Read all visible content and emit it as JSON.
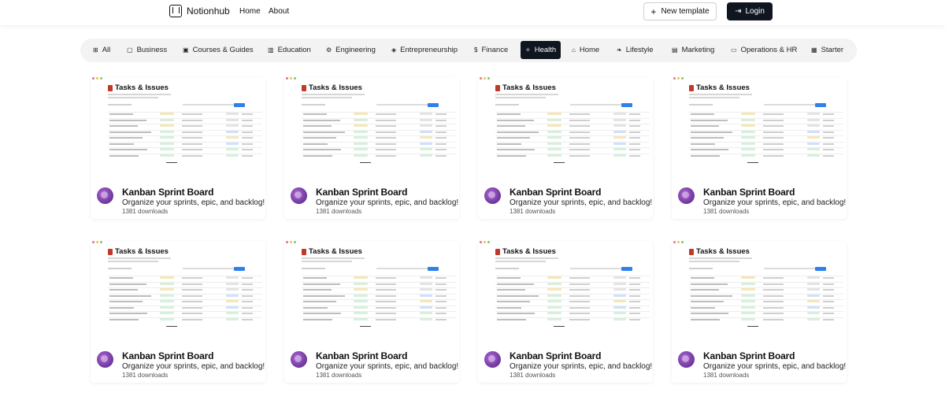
{
  "header": {
    "brand": "Notionhub",
    "nav": [
      "Home",
      "About"
    ],
    "new_template_label": "New template",
    "login_label": "Login"
  },
  "categories": [
    {
      "label": "All",
      "icon": "grid-icon",
      "glyph": "⊞",
      "active": false
    },
    {
      "label": "Business",
      "icon": "briefcase-icon",
      "glyph": "▢",
      "active": false
    },
    {
      "label": "Courses & Guides",
      "icon": "book-icon",
      "glyph": "▣",
      "active": false
    },
    {
      "label": "Education",
      "icon": "open-book-icon",
      "glyph": "▥",
      "active": false
    },
    {
      "label": "Engineering",
      "icon": "gear-icon",
      "glyph": "⚙",
      "active": false
    },
    {
      "label": "Entrepreneurship",
      "icon": "rocket-icon",
      "glyph": "◈",
      "active": false
    },
    {
      "label": "Finance",
      "icon": "dollar-icon",
      "glyph": "$",
      "active": false
    },
    {
      "label": "Health",
      "icon": "heart-pulse-icon",
      "glyph": "✧",
      "active": true
    },
    {
      "label": "Home",
      "icon": "house-icon",
      "glyph": "⌂",
      "active": false
    },
    {
      "label": "Lifestyle",
      "icon": "leaf-icon",
      "glyph": "❧",
      "active": false
    },
    {
      "label": "Marketing",
      "icon": "bar-chart-icon",
      "glyph": "▤",
      "active": false
    },
    {
      "label": "Operations & HR",
      "icon": "folder-icon",
      "glyph": "▭",
      "active": false
    },
    {
      "label": "Starter",
      "icon": "package-icon",
      "glyph": "▦",
      "active": false
    }
  ],
  "templates": [
    {
      "thumb_title": "Tasks & Issues",
      "title": "Kanban Sprint Board",
      "description": "Organize your sprints, epic, and backlog!",
      "downloads": "1381 downloads"
    },
    {
      "thumb_title": "Tasks & Issues",
      "title": "Kanban Sprint Board",
      "description": "Organize your sprints, epic, and backlog!",
      "downloads": "1381 downloads"
    },
    {
      "thumb_title": "Tasks & Issues",
      "title": "Kanban Sprint Board",
      "description": "Organize your sprints, epic, and backlog!",
      "downloads": "1381 downloads"
    },
    {
      "thumb_title": "Tasks & Issues",
      "title": "Kanban Sprint Board",
      "description": "Organize your sprints, epic, and backlog!",
      "downloads": "1381 downloads"
    },
    {
      "thumb_title": "Tasks & Issues",
      "title": "Kanban Sprint Board",
      "description": "Organize your sprints, epic, and backlog!",
      "downloads": "1381 downloads"
    },
    {
      "thumb_title": "Tasks & Issues",
      "title": "Kanban Sprint Board",
      "description": "Organize your sprints, epic, and backlog!",
      "downloads": "1381 downloads"
    },
    {
      "thumb_title": "Tasks & Issues",
      "title": "Kanban Sprint Board",
      "description": "Organize your sprints, epic, and backlog!",
      "downloads": "1381 downloads"
    },
    {
      "thumb_title": "Tasks & Issues",
      "title": "Kanban Sprint Board",
      "description": "Organize your sprints, epic, and backlog!",
      "downloads": "1381 downloads"
    }
  ],
  "colors": {
    "accent_dark": "#0f1620",
    "tag_green": "#d7f0dc",
    "tag_yellow": "#f6e7b8",
    "tag_blue": "#cfe1fb",
    "tag_gray": "#e4e4e4"
  }
}
